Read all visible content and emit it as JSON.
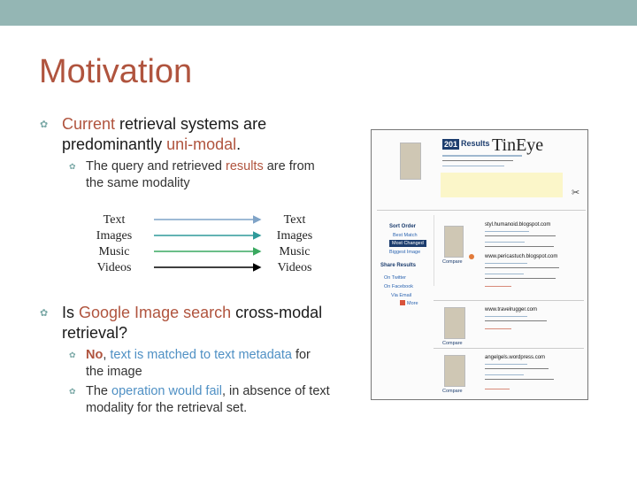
{
  "slide": {
    "title": "Motivation",
    "bullet1": {
      "hl": "Current",
      "rest": " retrieval systems are",
      "line2_pre": "predominantly ",
      "line2_hl": "uni-modal",
      "line2_post": "."
    },
    "sub1": {
      "pre": "The query and retrieved ",
      "hl": "results",
      "mid": " are from",
      "line2": "the same modality"
    },
    "modalities_left": [
      "Text",
      "Images",
      "Music",
      "Videos"
    ],
    "modalities_right": [
      "Text",
      "Images",
      "Music",
      "Videos"
    ],
    "bullet2": {
      "pre": "Is ",
      "hl": "Google Image search",
      "post": " cross-modal",
      "line2": "retrieval?"
    },
    "sub2": {
      "hl1": "No",
      "comma": ", ",
      "hl2": "text is matched to text metadata",
      "post": " for",
      "line2": "the image"
    },
    "sub3": {
      "pre": "The ",
      "hl": "operation would fail",
      "post": ", in absence of text",
      "line2": "modality for the retrieval set."
    }
  },
  "screenshot": {
    "results_count": "201",
    "results_label": "Results",
    "logo": "TinEye",
    "sort_order": "Sort Order",
    "best_match": "Best Match",
    "most_changed": "Most Changed",
    "biggest_image": "Biggest Image",
    "share_results": "Share Results",
    "on_twitter": "On Twitter",
    "on_facebook": "On Facebook",
    "via_email": "Via Email",
    "more": "More",
    "compare": "Compare",
    "domains": [
      "styl.humanoid.blogspot.com",
      "www.pericastuch.blogspot.com",
      "www.travelrugger.com",
      "angelgels.wordpress.com"
    ]
  },
  "colors": {
    "title": "#b0543e",
    "accent": "#b0543e",
    "topbar": "#94b6b4",
    "line_text": "#7fa3c7",
    "line_images": "#2f9a9a",
    "line_music": "#3aa860",
    "line_videos": "#000000"
  }
}
